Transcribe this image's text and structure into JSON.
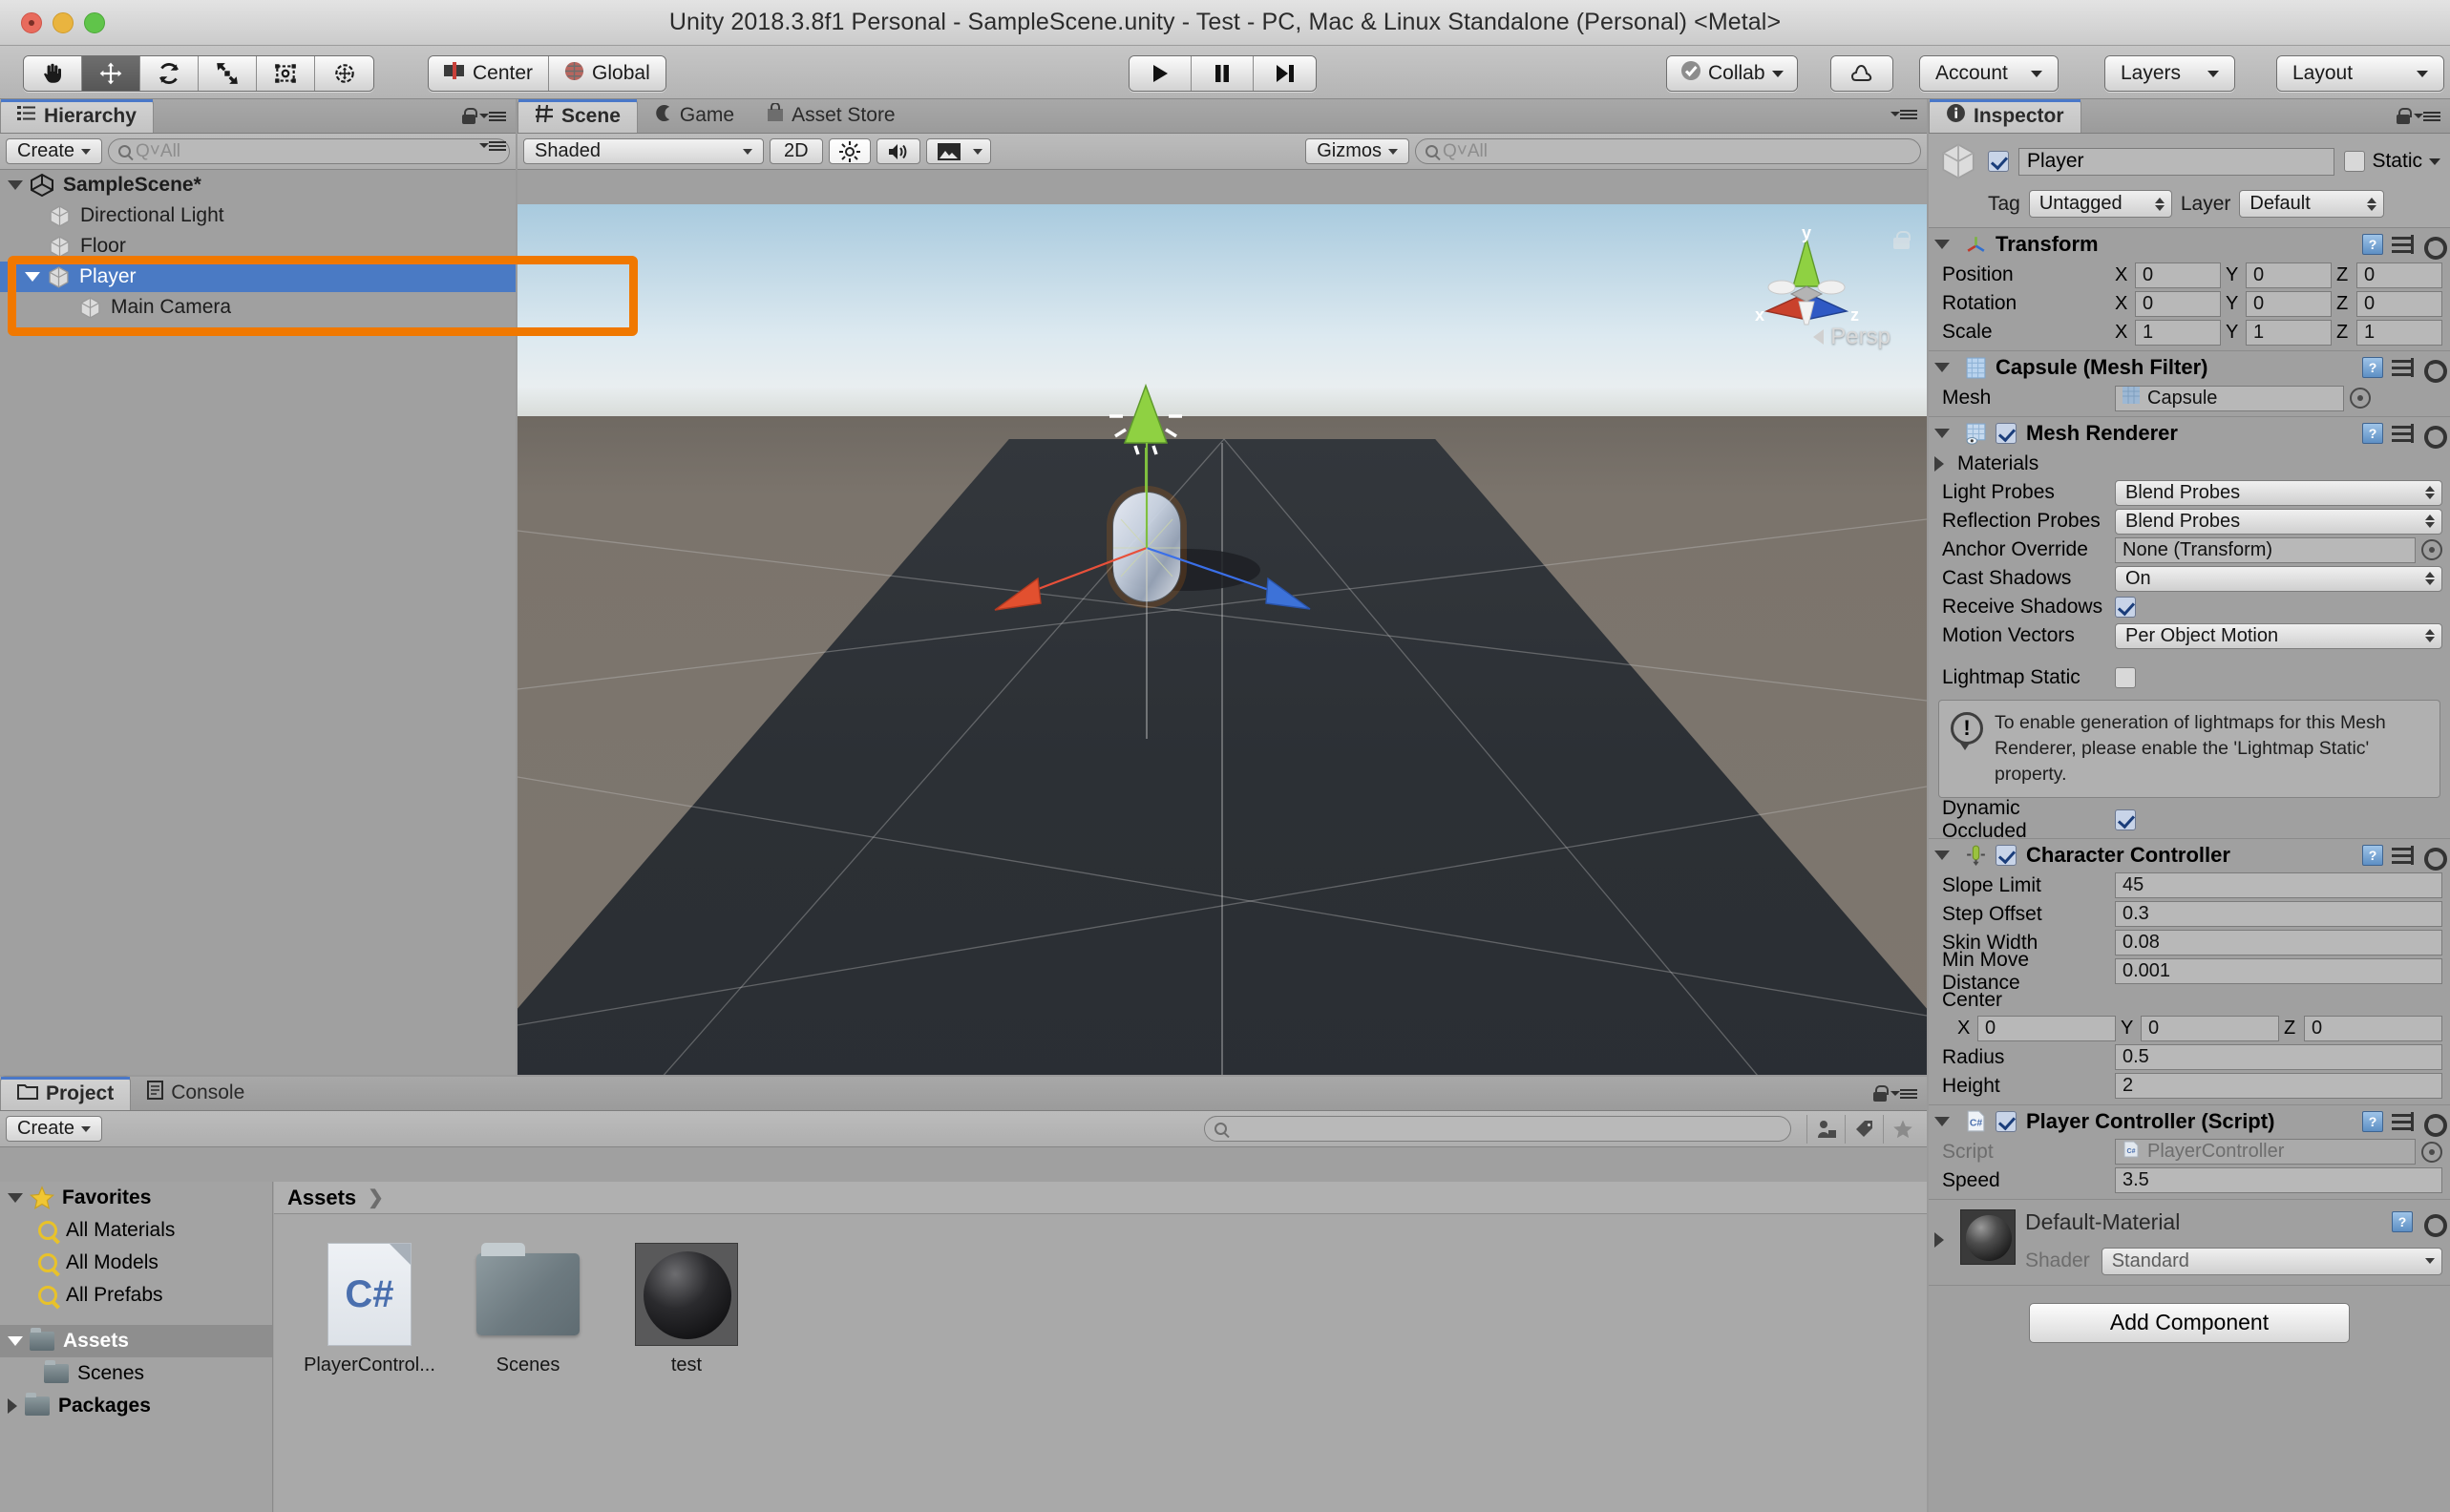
{
  "window": {
    "title": "Unity 2018.3.8f1 Personal - SampleScene.unity - Test - PC, Mac & Linux Standalone (Personal) <Metal>"
  },
  "toolbar": {
    "tools": [
      {
        "name": "hand-tool",
        "icon": "hand",
        "active": false
      },
      {
        "name": "move-tool",
        "icon": "move",
        "active": true
      },
      {
        "name": "rotate-tool",
        "icon": "rotate",
        "active": false
      },
      {
        "name": "scale-tool",
        "icon": "scale",
        "active": false
      },
      {
        "name": "rect-tool",
        "icon": "rect",
        "active": false
      },
      {
        "name": "transform-tool",
        "icon": "transform",
        "active": false
      }
    ],
    "pivot_label": "Center",
    "space_label": "Global",
    "play_label": "▶",
    "pause_label": "❚❚",
    "step_label": "▶❚",
    "collab_label": "Collab",
    "cloud_label": "cloud-icon",
    "account_label": "Account",
    "layers_label": "Layers",
    "layout_label": "Layout"
  },
  "hierarchy": {
    "tab_label": "Hierarchy",
    "create_label": "Create",
    "search_placeholder": "Q˅All",
    "scene_name": "SampleScene*",
    "items": [
      {
        "label": "Directional Light",
        "indent": 1,
        "selected": false,
        "expandable": false
      },
      {
        "label": "Floor",
        "indent": 1,
        "selected": false,
        "expandable": false
      },
      {
        "label": "Player",
        "indent": 1,
        "selected": true,
        "expandable": true
      },
      {
        "label": "Main Camera",
        "indent": 2,
        "selected": false,
        "expandable": false
      }
    ],
    "annotation_color": "#f07800"
  },
  "scene": {
    "tabs": [
      {
        "label": "Scene",
        "icon": "grid-icon",
        "active": true
      },
      {
        "label": "Game",
        "icon": "gamepad-icon",
        "active": false
      },
      {
        "label": "Asset Store",
        "icon": "store-icon",
        "active": false
      }
    ],
    "draw_mode": "Shaded",
    "mode_2d": "2D",
    "lighting_icon": "sun-icon",
    "audio_icon": "speaker-icon",
    "effects_icon": "image-icon",
    "gizmos_label": "Gizmos",
    "search_placeholder": "Q˅All",
    "persp_label": "Persp",
    "axis_labels": {
      "x": "x",
      "y": "y",
      "z": "z"
    }
  },
  "inspector": {
    "tab_label": "Inspector",
    "object_name": "Player",
    "object_enabled": true,
    "static_label": "Static",
    "static_checked": false,
    "tag_label": "Tag",
    "tag_value": "Untagged",
    "layer_label": "Layer",
    "layer_value": "Default",
    "components": [
      {
        "name": "Transform",
        "icon": "transform-icon",
        "has_checkbox": false,
        "rows": [
          {
            "type": "vec3",
            "label": "Position",
            "x": "0",
            "y": "0",
            "z": "0"
          },
          {
            "type": "vec3",
            "label": "Rotation",
            "x": "0",
            "y": "0",
            "z": "0"
          },
          {
            "type": "vec3",
            "label": "Scale",
            "x": "1",
            "y": "1",
            "z": "1"
          }
        ]
      },
      {
        "name": "Capsule (Mesh Filter)",
        "icon": "mesh-filter-icon",
        "has_checkbox": false,
        "rows": [
          {
            "type": "object",
            "label": "Mesh",
            "value": "Capsule"
          }
        ]
      },
      {
        "name": "Mesh Renderer",
        "icon": "mesh-renderer-icon",
        "has_checkbox": true,
        "checked": true,
        "rows": [
          {
            "type": "foldout",
            "label": "Materials"
          },
          {
            "type": "dropdown",
            "label": "Light Probes",
            "value": "Blend Probes"
          },
          {
            "type": "dropdown",
            "label": "Reflection Probes",
            "value": "Blend Probes"
          },
          {
            "type": "object",
            "label": "Anchor Override",
            "value": "None (Transform)"
          },
          {
            "type": "dropdown",
            "label": "Cast Shadows",
            "value": "On"
          },
          {
            "type": "checkbox",
            "label": "Receive Shadows",
            "checked": true
          },
          {
            "type": "dropdown",
            "label": "Motion Vectors",
            "value": "Per Object Motion"
          },
          {
            "type": "spacer"
          },
          {
            "type": "checkbox",
            "label": "Lightmap Static",
            "checked": false
          },
          {
            "type": "help",
            "text": "To enable generation of lightmaps for this Mesh Renderer, please enable the 'Lightmap Static' property."
          },
          {
            "type": "checkbox",
            "label": "Dynamic Occluded",
            "checked": true
          }
        ]
      },
      {
        "name": "Character Controller",
        "icon": "character-controller-icon",
        "has_checkbox": true,
        "checked": true,
        "rows": [
          {
            "type": "field",
            "label": "Slope Limit",
            "value": "45"
          },
          {
            "type": "field",
            "label": "Step Offset",
            "value": "0.3"
          },
          {
            "type": "field",
            "label": "Skin Width",
            "value": "0.08"
          },
          {
            "type": "field",
            "label": "Min Move Distance",
            "value": "0.001"
          },
          {
            "type": "label",
            "label": "Center"
          },
          {
            "type": "vec3-indent",
            "label": "",
            "x": "0",
            "y": "0",
            "z": "0"
          },
          {
            "type": "field",
            "label": "Radius",
            "value": "0.5"
          },
          {
            "type": "field",
            "label": "Height",
            "value": "2"
          }
        ]
      },
      {
        "name": "Player Controller (Script)",
        "icon": "csharp-icon",
        "has_checkbox": true,
        "checked": true,
        "rows": [
          {
            "type": "object-dim",
            "label": "Script",
            "value": "PlayerController"
          },
          {
            "type": "field",
            "label": "Speed",
            "value": "3.5"
          }
        ]
      }
    ],
    "material": {
      "name": "Default-Material",
      "shader_label": "Shader",
      "shader_value": "Standard"
    },
    "add_component_label": "Add Component"
  },
  "project": {
    "tabs": [
      {
        "label": "Project",
        "icon": "folder-icon",
        "active": true
      },
      {
        "label": "Console",
        "icon": "console-icon",
        "active": false
      }
    ],
    "create_label": "Create",
    "search_placeholder": "",
    "tree": [
      {
        "label": "Favorites",
        "type": "favorites",
        "indent": 0,
        "bold": true,
        "expanded": true
      },
      {
        "label": "All Materials",
        "type": "search",
        "indent": 1,
        "bold": false
      },
      {
        "label": "All Models",
        "type": "search",
        "indent": 1,
        "bold": false
      },
      {
        "label": "All Prefabs",
        "type": "search",
        "indent": 1,
        "bold": false
      },
      {
        "label": "Assets",
        "type": "folder",
        "indent": 0,
        "bold": true,
        "expanded": true,
        "selected": true
      },
      {
        "label": "Scenes",
        "type": "folder",
        "indent": 1,
        "bold": false
      },
      {
        "label": "Packages",
        "type": "folder",
        "indent": 0,
        "bold": true,
        "expanded": false
      }
    ],
    "breadcrumb": "Assets",
    "assets": [
      {
        "label": "PlayerControl...",
        "kind": "csharp"
      },
      {
        "label": "Scenes",
        "kind": "folder"
      },
      {
        "label": "test",
        "kind": "material"
      }
    ]
  }
}
